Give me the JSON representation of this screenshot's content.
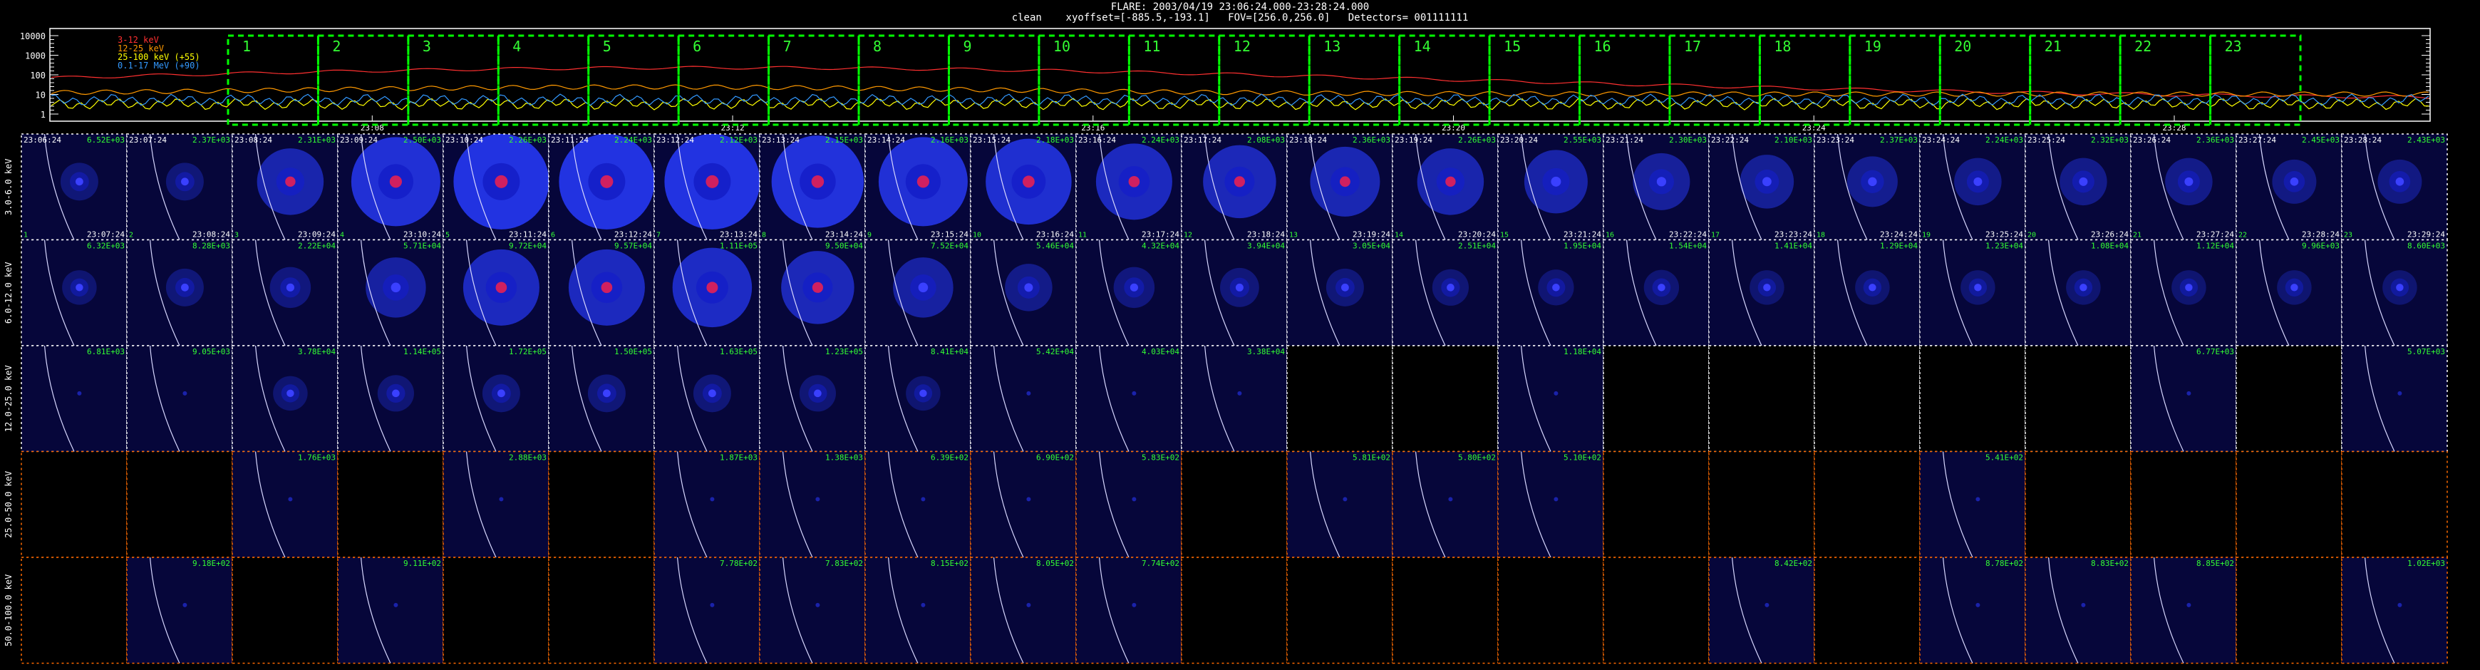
{
  "header": {
    "flare_line": "FLARE: 2003/04/19 23:06:24.000-23:28:24.000",
    "info_line": "clean    xyoffset=[-885.5,-193.1]   FOV=[256.0,256.0]   Detectors= 001111111"
  },
  "chart_data": [
    {
      "type": "line",
      "title": "",
      "y_scale": "log",
      "y_ticks": [
        "10000",
        "1000",
        "100",
        "10",
        "1"
      ],
      "x_ticks": [
        "23:08",
        "23:12",
        "23:16",
        "23:20",
        "23:24",
        "23:28"
      ],
      "legend_position": "top-left",
      "series": [
        {
          "name": "3-12 keV",
          "color": "#ff3030",
          "level": "high"
        },
        {
          "name": "12-25 keV",
          "color": "#ff9900",
          "level": "mid"
        },
        {
          "name": "25-100 keV (+55)",
          "color": "#ffff00",
          "level": "low"
        },
        {
          "name": "0.1-17 MeV (+90)",
          "color": "#3399ff",
          "level": "low"
        }
      ],
      "interval_markers": [
        "1",
        "2",
        "3",
        "4",
        "5",
        "6",
        "7",
        "8",
        "9",
        "10",
        "11",
        "12",
        "13",
        "14",
        "15",
        "16",
        "17",
        "18",
        "19",
        "20",
        "21",
        "22",
        "23"
      ]
    },
    {
      "type": "heatmap",
      "description_of_grid": "image cube: rows = energy bands, columns = time intervals",
      "energy_bands": [
        "3.0-6.0 keV",
        "6.0-12.0 keV",
        "12.0-25.0 keV",
        "25.0-50.0 keV",
        "50.0-100.0 keV"
      ],
      "row_border_colors": [
        "#ffffff",
        "#ffffff",
        "#ffffff",
        "#ff6a00",
        "#ff6a00"
      ],
      "time_starts": [
        "23:06:24",
        "23:07:24",
        "23:08:24",
        "23:09:24",
        "23:10:24",
        "23:11:24",
        "23:12:24",
        "23:13:24",
        "23:14:24",
        "23:15:24",
        "23:16:24",
        "23:17:24",
        "23:18:24",
        "23:19:24",
        "23:20:24",
        "23:21:24",
        "23:22:24",
        "23:23:24",
        "23:24:24",
        "23:25:24",
        "23:26:24",
        "23:27:24",
        "23:28:24"
      ],
      "time_ends": [
        "23:07:24",
        "23:08:24",
        "23:09:24",
        "23:10:24",
        "23:11:24",
        "23:12:24",
        "23:13:24",
        "23:14:24",
        "23:15:24",
        "23:16:24",
        "23:17:24",
        "23:18:24",
        "23:19:24",
        "23:20:24",
        "23:21:24",
        "23:22:24",
        "23:23:24",
        "23:24:24",
        "23:25:24",
        "23:26:24",
        "23:27:24",
        "23:28:24",
        "23:29:24"
      ],
      "peak_values": [
        [
          "6.52E+03",
          "2.37E+03",
          "2.31E+03",
          "2.50E+03",
          "2.26E+03",
          "2.24E+03",
          "2.12E+03",
          "2.15E+03",
          "2.16E+03",
          "2.18E+03",
          "2.24E+03",
          "2.08E+03",
          "2.36E+03",
          "2.26E+03",
          "2.55E+03",
          "2.30E+03",
          "2.10E+03",
          "2.37E+03",
          "2.24E+03",
          "2.32E+03",
          "2.36E+03",
          "2.45E+03",
          "2.43E+03"
        ],
        [
          "6.32E+03",
          "8.28E+03",
          "2.22E+04",
          "5.71E+04",
          "9.72E+04",
          "9.57E+04",
          "1.11E+05",
          "9.50E+04",
          "7.52E+04",
          "5.46E+04",
          "4.32E+04",
          "3.94E+04",
          "3.05E+04",
          "2.51E+04",
          "1.95E+04",
          "1.54E+04",
          "1.41E+04",
          "1.29E+04",
          "1.23E+04",
          "1.08E+04",
          "1.12E+04",
          "9.96E+03",
          "8.60E+03"
        ],
        [
          "6.81E+03",
          "9.05E+03",
          "3.78E+04",
          "1.14E+05",
          "1.72E+05",
          "1.50E+05",
          "1.63E+05",
          "1.23E+05",
          "8.41E+04",
          "5.42E+04",
          "4.03E+04",
          "3.38E+04",
          "",
          "",
          "1.18E+04",
          "",
          "",
          "",
          "",
          "",
          "6.77E+03",
          "",
          "5.07E+03"
        ],
        [
          "",
          "",
          "1.76E+03",
          "",
          "2.88E+03",
          "",
          "1.87E+03",
          "1.38E+03",
          "6.39E+02",
          "6.90E+02",
          "5.83E+02",
          "",
          "5.81E+02",
          "5.80E+02",
          "5.10E+02",
          "",
          "",
          "",
          "5.41E+02",
          "",
          "",
          "",
          ""
        ],
        [
          "",
          "9.18E+02",
          "",
          "9.11E+02",
          "",
          "",
          "7.78E+02",
          "7.83E+02",
          "8.15E+02",
          "8.05E+02",
          "7.74E+02",
          "",
          "",
          "",
          "",
          "",
          "8.42E+02",
          "",
          "8.78E+02",
          "8.83E+02",
          "8.85E+02",
          "",
          "1.02E+03"
        ]
      ],
      "brightness": [
        [
          0.1,
          0.1,
          0.55,
          0.9,
          1.0,
          1.0,
          1.0,
          0.95,
          0.9,
          0.85,
          0.7,
          0.65,
          0.6,
          0.55,
          0.5,
          0.4,
          0.35,
          0.3,
          0.25,
          0.25,
          0.25,
          0.2,
          0.2
        ],
        [
          0.05,
          0.1,
          0.15,
          0.45,
          0.7,
          0.7,
          0.75,
          0.65,
          0.45,
          0.25,
          0.15,
          0.12,
          0.1,
          0.08,
          0.07,
          0.06,
          0.05,
          0.05,
          0.05,
          0.05,
          0.05,
          0.05,
          0.05
        ],
        [
          0.02,
          0.02,
          0.05,
          0.08,
          0.1,
          0.1,
          0.1,
          0.08,
          0.05,
          0.03,
          0.02,
          0.02,
          0,
          0,
          0.02,
          0,
          0,
          0,
          0,
          0,
          0.02,
          0,
          0.02
        ],
        [
          0,
          0,
          0.02,
          0,
          0.02,
          0,
          0.02,
          0.02,
          0.02,
          0.02,
          0.02,
          0,
          0.02,
          0.02,
          0.02,
          0,
          0,
          0,
          0.02,
          0,
          0,
          0,
          0
        ],
        [
          0,
          0.02,
          0,
          0.02,
          0,
          0,
          0.02,
          0.02,
          0.02,
          0.02,
          0.02,
          0,
          0,
          0,
          0,
          0,
          0.02,
          0,
          0.02,
          0.02,
          0.02,
          0,
          0.02
        ]
      ],
      "colors": {
        "label_green": "#33ff33",
        "marker_green": "#00ff00",
        "background": "#000000",
        "image_bg": "#06063a"
      }
    }
  ]
}
